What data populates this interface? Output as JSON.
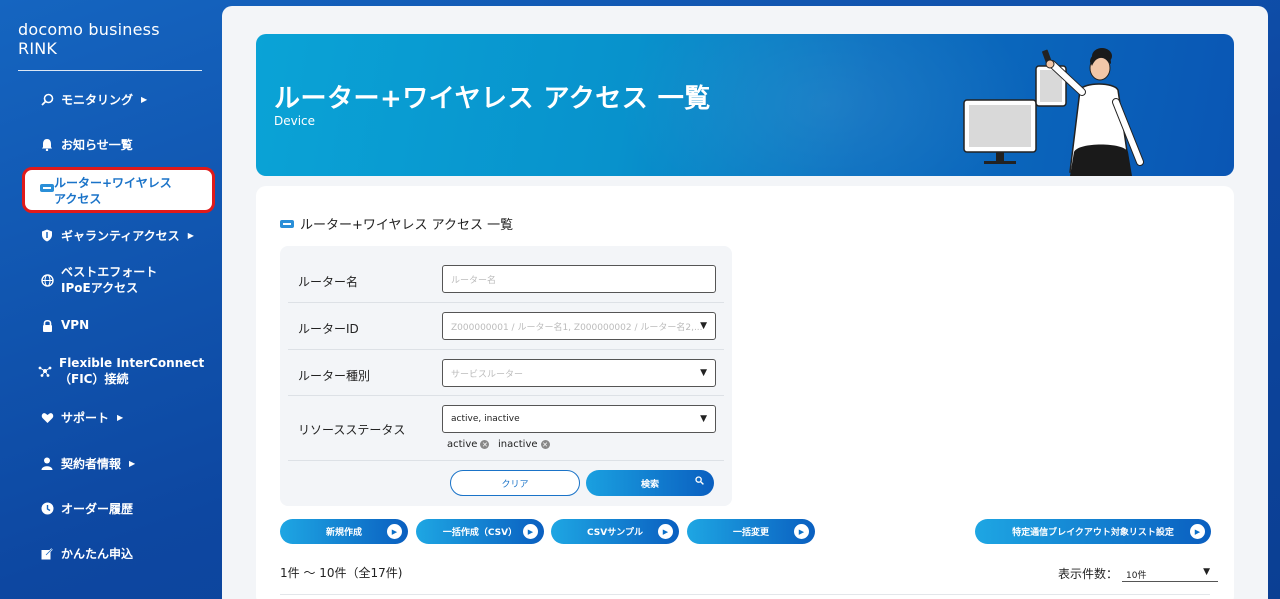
{
  "brand": "docomo business RINK",
  "nav": [
    {
      "label": "モニタリング",
      "icon": "search-chart-icon",
      "has_submenu": true
    },
    {
      "label": "お知らせ一覧",
      "icon": "bell-icon",
      "has_submenu": false
    },
    {
      "label_line1": "ルーター+ワイヤレス",
      "label_line2": "アクセス",
      "icon": "router-icon",
      "active": true
    },
    {
      "label": "ギャランティアクセス",
      "icon": "shield-icon",
      "has_submenu": true
    },
    {
      "label_line1": "ベストエフォート",
      "label_line2": "IPoEアクセス",
      "icon": "globe-icon"
    },
    {
      "label": "VPN",
      "icon": "lock-icon"
    },
    {
      "label_line1": "Flexible InterConnect",
      "label_line2": "（FIC）接続",
      "icon": "network-icon"
    },
    {
      "label": "サポート",
      "icon": "heart-hand-icon",
      "has_submenu": true
    },
    {
      "label": "契約者情報",
      "icon": "person-icon",
      "has_submenu": true
    },
    {
      "label": "オーダー履歴",
      "icon": "clock-icon"
    },
    {
      "label": "かんたん申込",
      "icon": "edit-icon"
    }
  ],
  "hero": {
    "title": "ルーター+ワイヤレス アクセス 一覧",
    "subtitle": "Device"
  },
  "card": {
    "title": "ルーター+ワイヤレス アクセス 一覧"
  },
  "form": {
    "router_name": {
      "label": "ルーター名",
      "placeholder": "ルーター名"
    },
    "router_id": {
      "label": "ルーターID",
      "placeholder": "Z000000001 / ルーター名1, Z000000002 / ルーター名2,..."
    },
    "router_type": {
      "label": "ルーター種別",
      "placeholder": "サービスルーター"
    },
    "resource_status": {
      "label": "リソースステータス",
      "value": "active, inactive",
      "chips": [
        "active",
        "inactive"
      ]
    },
    "clear_label": "クリア",
    "search_label": "検索"
  },
  "actions": {
    "new": "新規作成",
    "bulk_create": "一括作成（CSV）",
    "csv_sample": "CSVサンプル",
    "bulk_change": "一括変更",
    "breakout": "特定通信ブレイクアウト対象リスト設定"
  },
  "pagination": {
    "count_text": "1件 ～ 10件（全17件)",
    "per_page_label": "表示件数：",
    "per_page_value": "10件"
  },
  "colors": {
    "sidebar_bg": "#1565c0",
    "accent": "#1a73c8",
    "active_border": "#e01a1a"
  }
}
